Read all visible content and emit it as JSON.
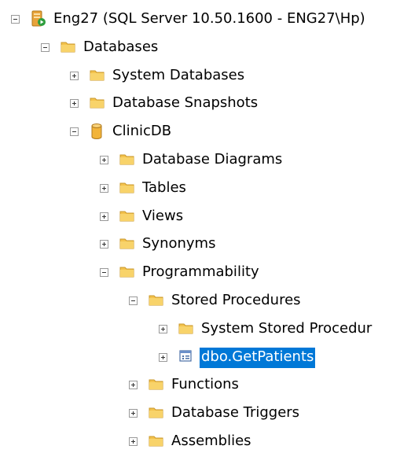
{
  "tree": {
    "rows": [
      {
        "label": "Eng27 (SQL Server 10.50.1600 - ENG27\\Hp)",
        "icon": "server-icon",
        "expander": "minus",
        "depth": 0
      },
      {
        "label": "Databases",
        "icon": "folder-icon",
        "expander": "minus",
        "depth": 1
      },
      {
        "label": "System Databases",
        "icon": "folder-icon",
        "expander": "plus",
        "depth": 2
      },
      {
        "label": "Database Snapshots",
        "icon": "folder-icon",
        "expander": "plus",
        "depth": 2
      },
      {
        "label": "ClinicDB",
        "icon": "database-icon",
        "expander": "minus",
        "depth": 2
      },
      {
        "label": "Database Diagrams",
        "icon": "folder-icon",
        "expander": "plus",
        "depth": 3
      },
      {
        "label": "Tables",
        "icon": "folder-icon",
        "expander": "plus",
        "depth": 3
      },
      {
        "label": "Views",
        "icon": "folder-icon",
        "expander": "plus",
        "depth": 3
      },
      {
        "label": "Synonyms",
        "icon": "folder-icon",
        "expander": "plus",
        "depth": 3
      },
      {
        "label": "Programmability",
        "icon": "folder-icon",
        "expander": "minus",
        "depth": 3
      },
      {
        "label": "Stored Procedures",
        "icon": "folder-icon",
        "expander": "minus",
        "depth": 4
      },
      {
        "label": "System Stored Procedur",
        "icon": "folder-icon",
        "expander": "plus",
        "depth": 5
      },
      {
        "label": "dbo.GetPatients",
        "icon": "stored-procedure-icon",
        "expander": "plus",
        "depth": 5,
        "selected": true
      },
      {
        "label": "Functions",
        "icon": "folder-icon",
        "expander": "plus",
        "depth": 4
      },
      {
        "label": "Database Triggers",
        "icon": "folder-icon",
        "expander": "plus",
        "depth": 4
      },
      {
        "label": "Assemblies",
        "icon": "folder-icon",
        "expander": "plus",
        "depth": 4
      }
    ]
  },
  "colors": {
    "selection": "#0078d7",
    "folder": "#f4c34d",
    "server": "#e8a33a",
    "server_badge": "#2e9e3e",
    "database": "#f2b43a"
  }
}
